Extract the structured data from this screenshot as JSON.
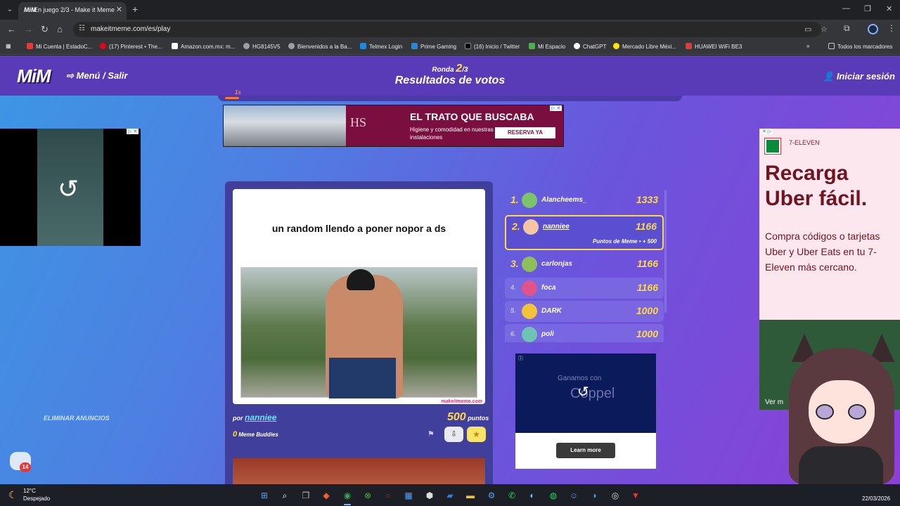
{
  "browser": {
    "tab_title": "En juego 2/3 - Make it Meme",
    "tab_favicon": "MiM",
    "url": "makeitmeme.com/es/play",
    "bookmarks": [
      {
        "label": "Mi Cuenta | EstadoC...",
        "color": "#e53935"
      },
      {
        "label": "(17) Pinterest • The...",
        "color": "#e60023"
      },
      {
        "label": "Amazon.com.mx: m...",
        "color": "#ffffff"
      },
      {
        "label": "HG8145V5",
        "color": "#9aa0a6"
      },
      {
        "label": "Bienvenidos a la Ba...",
        "color": "#9aa0a6"
      },
      {
        "label": "Telmex Login",
        "color": "#1e88e5"
      },
      {
        "label": "Prime Gaming",
        "color": "#1e88e5"
      },
      {
        "label": "(16) Inicio / Twitter",
        "color": "#000000"
      },
      {
        "label": "Mi Espacio",
        "color": "#4caf50"
      },
      {
        "label": "ChatGPT",
        "color": "#ffffff"
      },
      {
        "label": "Mercado Libre Méxi...",
        "color": "#ffe600"
      },
      {
        "label": "HUAWEI WiFi BE3",
        "color": "#e53935"
      }
    ],
    "all_bookmarks": "Todos los marcadores"
  },
  "header": {
    "logo": "MiM",
    "menu": "Menú / Salir",
    "round_prefix": "Ronda",
    "round_current": "2",
    "round_total": "/3",
    "title": "Resultados de votos",
    "login": "Iniciar sesión",
    "timer": "1s"
  },
  "ad_top": {
    "logo": "HS",
    "headline": "EL TRATO QUE BUSCABA",
    "sub": "Higiene y comodidad en nuestras instalaciones",
    "button": "RESERVA YA"
  },
  "ad_right": {
    "brand": "7-ELEVEN",
    "headline": "Recarga Uber fácil.",
    "body": "Compra códigos o tarjetas Uber y Uber Eats en tu 7-Eleven más cercano.",
    "more": "Ver m"
  },
  "remove_ads": "ELIMINAR ANUNCIOS",
  "chat_badge": "14",
  "meme": {
    "caption": "un random llendo a poner nopor a ds",
    "watermark": "makeitmeme.com",
    "by_label": "por",
    "author": "nanniee",
    "points": "500",
    "points_label": "puntos",
    "buddies": "0",
    "buddies_label": "Meme Buddies"
  },
  "leaderboard": [
    {
      "rank": "1.",
      "name": "Alancheems_",
      "score": "1333",
      "avatar": "#7bc46a"
    },
    {
      "rank": "2.",
      "name": "nanniee",
      "score": "1166",
      "avatar": "#f4c7a4",
      "bonus": "Puntos de Meme • + 500"
    },
    {
      "rank": "3.",
      "name": "carlonjas",
      "score": "1166",
      "avatar": "#8fbf5a"
    },
    {
      "rank": "4.",
      "name": "foca",
      "score": "1166",
      "avatar": "#e0548a"
    },
    {
      "rank": "5.",
      "name": "DARK",
      "score": "1000",
      "avatar": "#f2c33a"
    },
    {
      "rank": "6.",
      "name": "poli",
      "score": "1000",
      "avatar": "#6fc3b4"
    }
  ],
  "ad_coppel": {
    "text": "Ganamos con",
    "brand": "Coppel",
    "button": "Learn more"
  },
  "taskbar": {
    "temp": "12°C",
    "weather": "Despejado",
    "date": "22/03/2026"
  }
}
